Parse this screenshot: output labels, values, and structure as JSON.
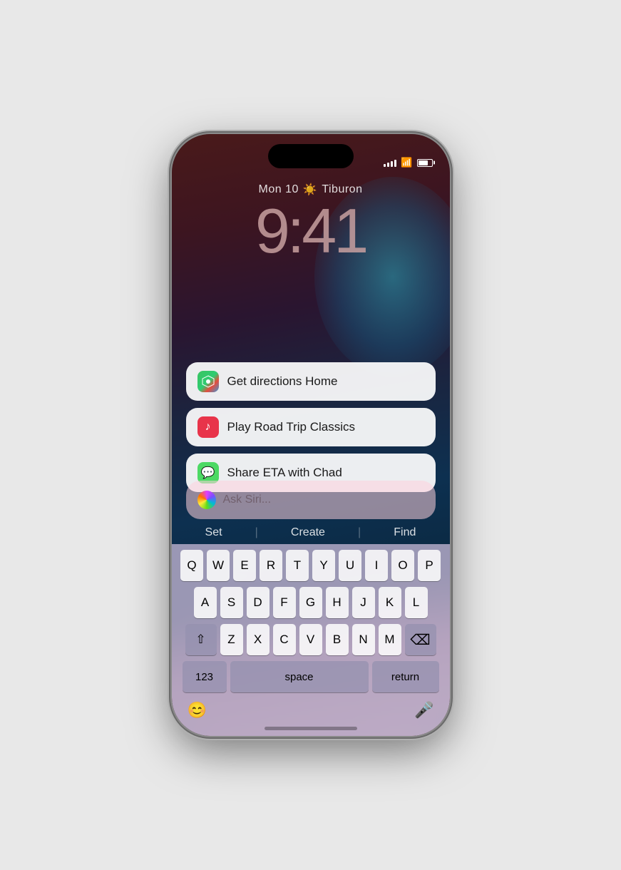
{
  "phone": {
    "status": {
      "time_placeholder": "",
      "signal_label": "signal",
      "wifi_label": "wifi",
      "battery_label": "battery"
    },
    "lock_screen": {
      "date": "Mon 10",
      "location": "Tiburon",
      "time": "9:41"
    },
    "suggestions": [
      {
        "id": "directions",
        "icon": "🗺️",
        "icon_type": "maps",
        "label": "Get directions Home"
      },
      {
        "id": "music",
        "icon": "♪",
        "icon_type": "music",
        "label": "Play Road Trip Classics"
      },
      {
        "id": "messages",
        "icon": "💬",
        "icon_type": "messages",
        "label": "Share ETA with Chad"
      }
    ],
    "siri": {
      "placeholder": "Ask Siri..."
    },
    "quick_suggestions": {
      "set": "Set",
      "create": "Create",
      "find": "Find"
    },
    "keyboard": {
      "row1": [
        "Q",
        "W",
        "E",
        "R",
        "T",
        "Y",
        "U",
        "I",
        "O",
        "P"
      ],
      "row2": [
        "A",
        "S",
        "D",
        "F",
        "G",
        "H",
        "J",
        "K",
        "L"
      ],
      "row3": [
        "Z",
        "X",
        "C",
        "V",
        "B",
        "N",
        "M"
      ],
      "space_label": "space",
      "return_label": "return",
      "num_label": "123",
      "emoji_label": "😊",
      "mic_label": "🎤",
      "delete_symbol": "⌫",
      "shift_symbol": "⇧"
    }
  }
}
